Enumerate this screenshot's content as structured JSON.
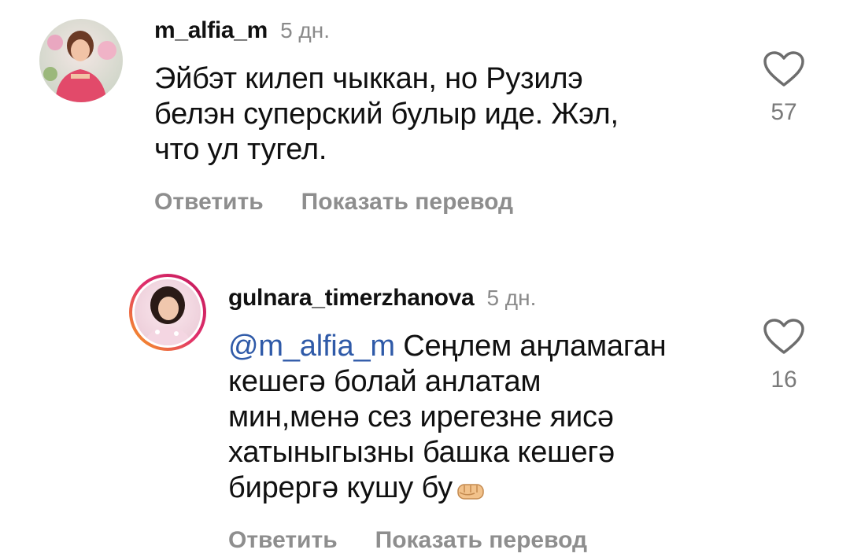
{
  "comments": [
    {
      "username": "m_alfia_m",
      "time": "5 дн.",
      "lines": [
        "Эйбэт килеп чыккан, но Рузилэ",
        "белэн суперский булыр иде. Жэл,",
        "что ул тугел."
      ],
      "reply_label": "Ответить",
      "translate_label": "Показать перевод",
      "likes": "57",
      "avatar_icon": "profile-photo"
    },
    {
      "username": "gulnara_timerzhanova",
      "time": "5 дн.",
      "mention": "@m_alfia_m",
      "first_line_rest": " Сеңлем аңламаган",
      "lines": [
        "кешегә болай анлатам",
        "мин,менә сез ирегезне яисә",
        "хатыныгызны башка кешегә",
        "бирергә кушу бу"
      ],
      "emoji": "fist-emoji",
      "reply_label": "Ответить",
      "translate_label": "Показать перевод",
      "likes": "16",
      "avatar_icon": "profile-photo-story-ring"
    }
  ],
  "colors": {
    "mention": "#2f5aa8",
    "secondary_text": "#8e8e8e",
    "story_ring_start": "#f9a51a",
    "story_ring_end": "#c2185b"
  }
}
